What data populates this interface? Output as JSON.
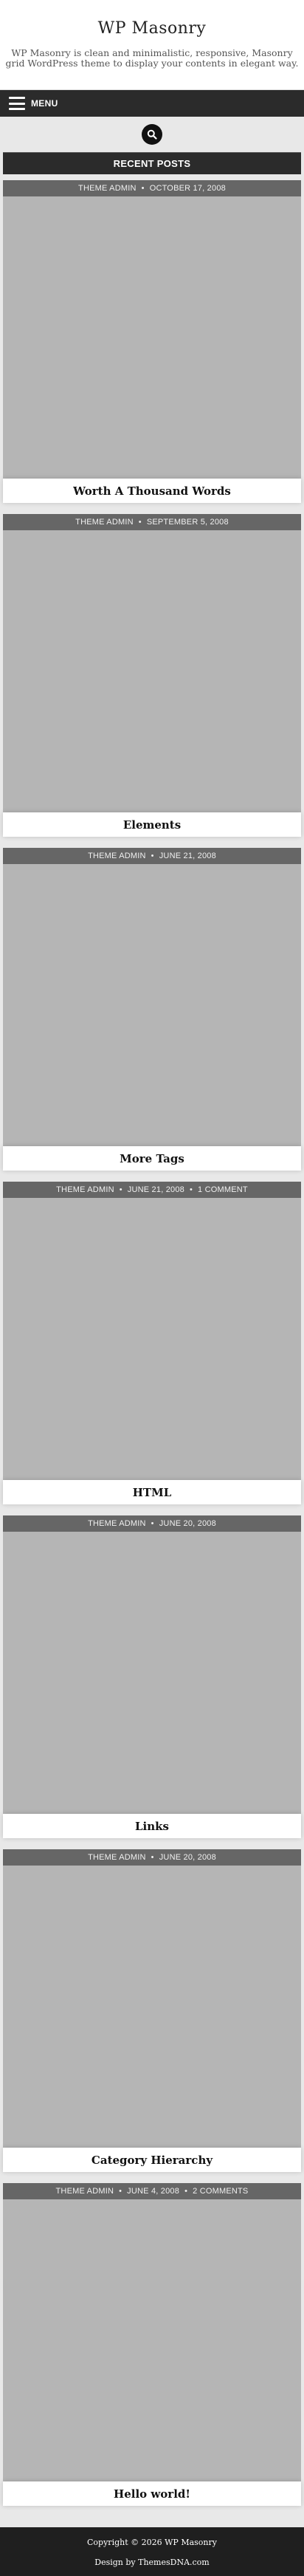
{
  "site": {
    "title": "WP Masonry",
    "description": "WP Masonry is clean and minimalistic, responsive, Masonry grid WordPress theme to display your contents in elegant way."
  },
  "nav": {
    "menu_label": "MENU",
    "menu_icon": "hamburger-icon",
    "search_icon": "search-icon"
  },
  "section": {
    "title": "RECENT POSTS"
  },
  "posts": [
    {
      "author": "THEME ADMIN",
      "date": "OCTOBER 17, 2008",
      "comments": "",
      "title": "Worth A Thousand Words"
    },
    {
      "author": "THEME ADMIN",
      "date": "SEPTEMBER 5, 2008",
      "comments": "",
      "title": "Elements"
    },
    {
      "author": "THEME ADMIN",
      "date": "JUNE 21, 2008",
      "comments": "",
      "title": "More Tags"
    },
    {
      "author": "THEME ADMIN",
      "date": "JUNE 21, 2008",
      "comments": "1 COMMENT",
      "title": "HTML"
    },
    {
      "author": "THEME ADMIN",
      "date": "JUNE 20, 2008",
      "comments": "",
      "title": "Links"
    },
    {
      "author": "THEME ADMIN",
      "date": "JUNE 20, 2008",
      "comments": "",
      "title": "Category Hierarchy"
    },
    {
      "author": "THEME ADMIN",
      "date": "JUNE 4, 2008",
      "comments": "2 COMMENTS",
      "title": "Hello world!"
    }
  ],
  "footer": {
    "copyright": "Copyright © 2026 WP Masonry",
    "credit": "Design by ThemesDNA.com"
  },
  "colors": {
    "background": "#e8e8e8",
    "bar": "#2b2b2b",
    "meta_bar": "#666666",
    "thumbnail": "#b5b5b5"
  }
}
